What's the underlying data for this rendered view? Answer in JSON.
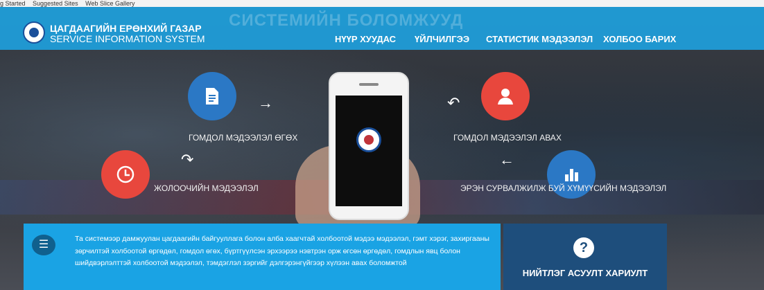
{
  "bookmarks": [
    "g Started",
    "Suggested Sites",
    "Web Slice Gallery"
  ],
  "brand": {
    "line1": "ЦАГДААГИЙН ЕРӨНХИЙ ГАЗАР",
    "line2": "SERVICE INFORMATION SYSTEM"
  },
  "hero_ghost_title": "СИСТЕМИЙН БОЛОМЖУУД",
  "nav": [
    {
      "label": "НҮҮР ХУУДАС"
    },
    {
      "label": "ҮЙЛЧИЛГЭЭ"
    },
    {
      "label": "СТАТИСТИК МЭДЭЭЛЭЛ"
    },
    {
      "label": "ХОЛБОО БАРИХ"
    }
  ],
  "features": {
    "report": {
      "label": "ГОМДОЛ МЭДЭЭЛЭЛ ӨГӨХ",
      "icon": "document-icon"
    },
    "receive": {
      "label": "ГОМДОЛ МЭДЭЭЛЭЛ АВАХ",
      "icon": "user-icon"
    },
    "driver": {
      "label": "ЖОЛООЧИЙН МЭДЭЭЛЭЛ",
      "icon": "clock-icon"
    },
    "missing": {
      "label": "ЭРЭН СУРВАЛЖИЛЖ БУЙ ХҮМҮҮСИЙН МЭДЭЭЛЭЛ",
      "icon": "bar-chart-icon"
    }
  },
  "info": {
    "text": "Та системээр дамжуулан цагдаагийн байгууллага болон алба хаагчтай холбоотой мэдээ мэдээлэл, гэмт хэрэг, захиргааны зөрчилтэй холбоотой өргөдөл, гомдол өгөх, бүртгүүлсэн эрхээрээ нэвтрэн орж өгсөн өргөдөл, гомдлын явц болон шийдвэрлэлттэй холбоотой мэдээлэл, тэмдэглэл зэргийг дэлгэрэнгүйгээр хүлээн авах боломжтой"
  },
  "faq": {
    "label": "НИЙТЛЭГ АСУУЛТ ХАРИУЛТ",
    "icon_glyph": "?"
  },
  "colors": {
    "nav_blue": "#1ea0dc",
    "info_blue": "#1aa3e4",
    "faq_navy": "#1e4e7c",
    "accent_red": "#e8473d",
    "accent_blue": "#2b78c5"
  }
}
